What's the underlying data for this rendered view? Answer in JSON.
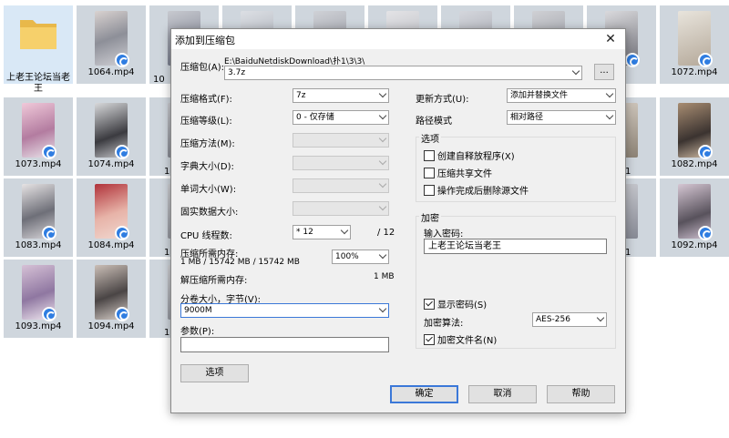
{
  "files": [
    {
      "name": "上老王论坛当老王",
      "kind": "folder"
    },
    {
      "name": "1064.mp4",
      "kind": "video"
    },
    {
      "name": "1072.mp4",
      "kind": "video"
    },
    {
      "name": "1073.mp4",
      "kind": "video"
    },
    {
      "name": "1074.mp4",
      "kind": "video"
    },
    {
      "name": "1082.mp4",
      "kind": "video"
    },
    {
      "name": "1083.mp4",
      "kind": "video"
    },
    {
      "name": "1084.mp4",
      "kind": "video"
    },
    {
      "name": "1092.mp4",
      "kind": "video"
    },
    {
      "name": "1093.mp4",
      "kind": "video"
    },
    {
      "name": "1094.mp4",
      "kind": "video"
    }
  ],
  "partial_names": [
    "10",
    "1",
    "1",
    "1",
    "1",
    "1"
  ],
  "dialog": {
    "title": "添加到压缩包",
    "close_glyph": "✕",
    "archive_label": "压缩包(A):",
    "archive_path": "E:\\BaiduNetdiskDownload\\扑1\\3\\3\\",
    "archive_name": "3.7z",
    "browse_label": "...",
    "format_label": "压缩格式(F):",
    "format_value": "7z",
    "level_label": "压缩等级(L):",
    "level_value": "0 - 仅存储",
    "method_label": "压缩方法(M):",
    "dict_label": "字典大小(D):",
    "word_label": "单词大小(W):",
    "solid_label": "固实数据大小:",
    "threads_label": "CPU 线程数:",
    "threads_value": "* 12",
    "threads_max": "/ 12",
    "mem_comp_label": "压缩所需内存:",
    "mem_comp_value": "1 MB / 15742 MB / 15742 MB",
    "mem_pct": "100%",
    "mem_decomp_label": "解压缩所需内存:",
    "mem_decomp_value": "1 MB",
    "split_label": "分卷大小，字节(V):",
    "split_value": "9000M",
    "params_label": "参数(P):",
    "params_value": "",
    "options_button": "选项",
    "update_label": "更新方式(U):",
    "update_value": "添加并替换文件",
    "path_label": "路径模式",
    "path_value": "相对路径",
    "options_group": "选项",
    "opt_sfx": "创建自释放程序(X)",
    "opt_shared": "压缩共享文件",
    "opt_delete": "操作完成后删除源文件",
    "encrypt_group": "加密",
    "pwd_label": "输入密码:",
    "pwd_value": "上老王论坛当老王",
    "show_pwd": "显示密码(S)",
    "enc_method_label": "加密算法:",
    "enc_method_value": "AES-256",
    "enc_names": "加密文件名(N)",
    "ok": "确定",
    "cancel": "取消",
    "help": "帮助"
  }
}
